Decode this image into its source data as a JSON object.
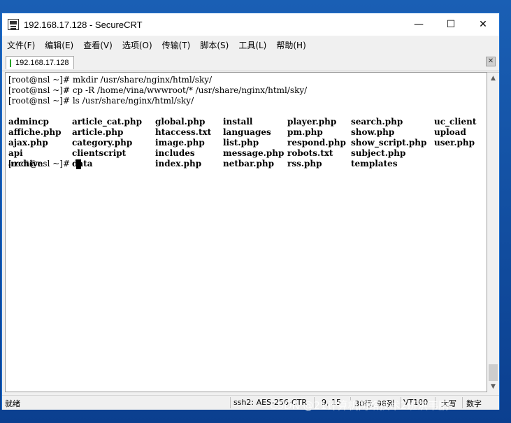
{
  "window": {
    "title": "192.168.17.128 - SecureCRT",
    "controls": {
      "minimize": "—",
      "maximize": "☐",
      "close": "✕"
    }
  },
  "menu": [
    "文件(F)",
    "编辑(E)",
    "查看(V)",
    "选项(O)",
    "传输(T)",
    "脚本(S)",
    "工具(L)",
    "帮助(H)"
  ],
  "tab": {
    "label": "192.168.17.128",
    "close": "✕"
  },
  "terminal": {
    "commands": [
      "[root@nsl ~]# mkdir /usr/share/nginx/html/sky/",
      "[root@nsl ~]# cp -R /home/vina/wwwroot/* /usr/share/nginx/html/sky/",
      "[root@nsl ~]# ls /usr/share/nginx/html/sky/"
    ],
    "ls_rows": [
      [
        "admincp",
        "article_cat.php",
        "global.php",
        "install",
        "player.php",
        "search.php",
        "uc_client"
      ],
      [
        "affiche.php",
        "article.php",
        "htaccess.txt",
        "languages",
        "pm.php",
        "show.php",
        "upload"
      ],
      [
        "ajax.php",
        "category.php",
        "image.php",
        "list.php",
        "respond.php",
        "show_script.php",
        "user.php"
      ],
      [
        "api",
        "clientscript",
        "includes",
        "message.php",
        "robots.txt",
        "subject.php",
        ""
      ],
      [
        "archive",
        "data",
        "index.php",
        "netbar.php",
        "rss.php",
        "templates",
        ""
      ]
    ],
    "prompt": "[root@nsl ~]# "
  },
  "statusbar": {
    "ready": "就绪",
    "encryption": "ssh2: AES-256-CTR",
    "cursor_pos": "9, 15",
    "size": "30行, 98列",
    "emulation": "VT100",
    "caps": "大写",
    "num": "数字"
  },
  "watermark": "CSDN @21计算机网络技术2班洪韦鹏"
}
